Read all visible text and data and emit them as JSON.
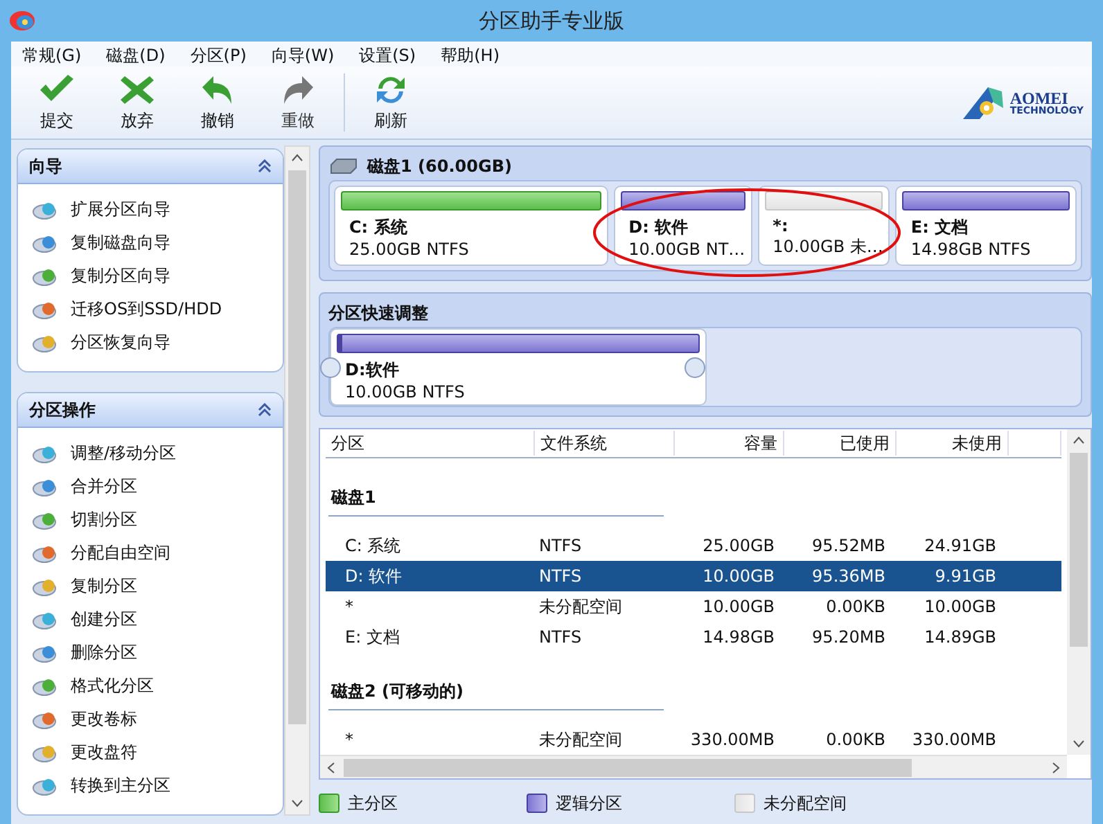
{
  "window": {
    "title": "分区助手专业版"
  },
  "menu": [
    "常规(G)",
    "磁盘(D)",
    "分区(P)",
    "向导(W)",
    "设置(S)",
    "帮助(H)"
  ],
  "toolbar": [
    {
      "kind": "apply",
      "label": "提交",
      "disabled": false
    },
    {
      "kind": "discard",
      "label": "放弃",
      "disabled": false
    },
    {
      "kind": "undo",
      "label": "撤销",
      "disabled": false
    },
    {
      "kind": "redo",
      "label": "重做",
      "disabled": true
    },
    {
      "kind": "refresh",
      "label": "刷新",
      "disabled": false
    }
  ],
  "logo": {
    "name": "AOMEI",
    "subtitle": "TECHNOLOGY"
  },
  "sidebar": [
    {
      "title": "向导",
      "items": [
        "扩展分区向导",
        "复制磁盘向导",
        "复制分区向导",
        "迁移OS到SSD/HDD",
        "分区恢复向导"
      ]
    },
    {
      "title": "分区操作",
      "items": [
        "调整/移动分区",
        "合并分区",
        "切割分区",
        "分配自由空间",
        "复制分区",
        "创建分区",
        "删除分区",
        "格式化分区",
        "更改卷标",
        "更改盘符",
        "转换到主分区"
      ]
    }
  ],
  "disk_map": {
    "title": "磁盘1 (60.00GB)",
    "partitions": [
      {
        "kind": "primary",
        "name": "C: 系统",
        "info": "25.00GB NTFS",
        "selected": false
      },
      {
        "kind": "logical",
        "name": "D: 软件",
        "info": "10.00GB NT…",
        "selected": false
      },
      {
        "kind": "unallocated",
        "name": "*:",
        "info": "10.00GB 未…",
        "selected": false
      },
      {
        "kind": "logical",
        "name": "E: 文档",
        "info": "14.98GB NTFS",
        "selected": false
      }
    ]
  },
  "quick_adjust": {
    "title": "分区快速调整",
    "partition": {
      "kind": "logical",
      "name": "D:软件",
      "info": "10.00GB NTFS"
    }
  },
  "table": {
    "columns": [
      "分区",
      "文件系统",
      "容量",
      "已使用",
      "未使用"
    ],
    "groups": [
      {
        "title": "磁盘1",
        "rows": [
          {
            "cells": [
              "C: 系统",
              "NTFS",
              "25.00GB",
              "95.52MB",
              "24.91GB"
            ],
            "selected": false
          },
          {
            "cells": [
              "D: 软件",
              "NTFS",
              "10.00GB",
              "95.36MB",
              "9.91GB"
            ],
            "selected": true
          },
          {
            "cells": [
              "*",
              "未分配空间",
              "10.00GB",
              "0.00KB",
              "10.00GB"
            ],
            "selected": false
          },
          {
            "cells": [
              "E: 文档",
              "NTFS",
              "14.98GB",
              "95.20MB",
              "14.89GB"
            ],
            "selected": false
          }
        ]
      },
      {
        "title": "磁盘2 (可移动的)",
        "rows": [
          {
            "cells": [
              "*",
              "未分配空间",
              "330.00MB",
              "0.00KB",
              "330.00MB"
            ],
            "selected": false
          }
        ]
      }
    ]
  },
  "legend": [
    {
      "kind": "primary",
      "label": "主分区"
    },
    {
      "kind": "logical",
      "label": "逻辑分区"
    },
    {
      "kind": "unallocated",
      "label": "未分配空间"
    }
  ]
}
